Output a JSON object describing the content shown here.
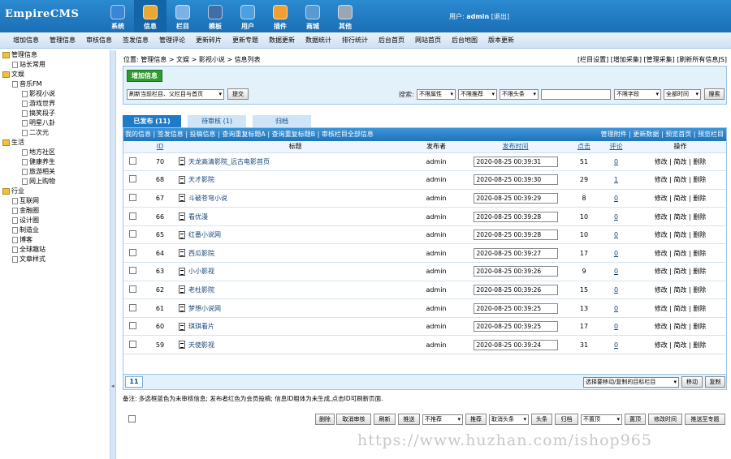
{
  "app": {
    "logo": "EmpireCMS",
    "user_label": "用户:",
    "user_name": "admin",
    "logout": "[退出]"
  },
  "topnav": [
    {
      "label": "系统",
      "color": "#3a86d6"
    },
    {
      "label": "信息",
      "color": "#e8a833"
    },
    {
      "label": "栏目",
      "color": "#7db1e6"
    },
    {
      "label": "模板",
      "color": "#3f6ea8"
    },
    {
      "label": "用户",
      "color": "#4aa0e0"
    },
    {
      "label": "插件",
      "color": "#f0a030"
    },
    {
      "label": "商城",
      "color": "#5a9ad0"
    },
    {
      "label": "其他",
      "color": "#9aa6b4"
    }
  ],
  "subnav": [
    "增加信息",
    "管理信息",
    "审核信息",
    "签发信息",
    "管理评论",
    "更新碎片",
    "更新专题",
    "数据更新",
    "数据统计",
    "排行统计",
    "后台首页",
    "网站首页",
    "后台地图",
    "版本更新"
  ],
  "sidebar": [
    {
      "label": "管理信息",
      "indent": 0,
      "type": "root"
    },
    {
      "label": "站长常用",
      "indent": 1,
      "type": "page"
    },
    {
      "label": "文娱",
      "indent": 0,
      "type": "folder"
    },
    {
      "label": "音乐FM",
      "indent": 1,
      "type": "page"
    },
    {
      "label": "影视小说",
      "indent": 2,
      "type": "page"
    },
    {
      "label": "游戏世界",
      "indent": 2,
      "type": "page"
    },
    {
      "label": "搞笑段子",
      "indent": 2,
      "type": "page"
    },
    {
      "label": "明星八卦",
      "indent": 2,
      "type": "page"
    },
    {
      "label": "二次元",
      "indent": 2,
      "type": "page"
    },
    {
      "label": "生活",
      "indent": 0,
      "type": "folder"
    },
    {
      "label": "地方社区",
      "indent": 2,
      "type": "page"
    },
    {
      "label": "健康养生",
      "indent": 2,
      "type": "page"
    },
    {
      "label": "旅游相关",
      "indent": 2,
      "type": "page"
    },
    {
      "label": "网上购物",
      "indent": 2,
      "type": "page"
    },
    {
      "label": "行业",
      "indent": 0,
      "type": "folder"
    },
    {
      "label": "互联网",
      "indent": 1,
      "type": "page"
    },
    {
      "label": "金融圈",
      "indent": 1,
      "type": "page"
    },
    {
      "label": "设计圈",
      "indent": 1,
      "type": "page"
    },
    {
      "label": "制造业",
      "indent": 1,
      "type": "page"
    },
    {
      "label": "博客",
      "indent": 1,
      "type": "page"
    },
    {
      "label": "全球趣站",
      "indent": 1,
      "type": "page"
    },
    {
      "label": "文章样式",
      "indent": 1,
      "type": "page"
    }
  ],
  "breadcrumb": "位置: 管理信息 > 文娱 > 影视小说 > 信息列表",
  "top_links": "[栏目设置] [增加采集] [管理采集] [刷新所有信息JS]",
  "add_button": "增加信息",
  "refresh_select": "刷新当前栏目、父栏目与首页",
  "submit_button": "提交",
  "search_label": "搜索:",
  "search_selects": [
    "不限属性",
    "不限推荐",
    "不限头条"
  ],
  "field_select": "不限字段",
  "time_select": "全部时间",
  "search_button": "搜索",
  "tabs": [
    {
      "label": "已发布 (11)",
      "active": true
    },
    {
      "label": "待审核 (1)",
      "active": false
    },
    {
      "label": "归档",
      "active": false
    }
  ],
  "actbar_left": "我的信息 | 签发信息 | 投稿信息 | 查询重复标题A | 查询重复标题B | 审核栏目全部信息",
  "actbar_right": "管理附件 | 更新数据 | 预览首页 | 预览栏目",
  "columns": {
    "id": "ID",
    "title": "标题",
    "publisher": "发布者",
    "time": "发布时间",
    "clicks": "点击",
    "comments": "评论",
    "ops": "操作"
  },
  "rows": [
    {
      "id": "70",
      "title": "天龙高清影院_远古电影首页",
      "publisher": "admin",
      "time": "2020-08-25 00:39:31",
      "clicks": "51",
      "comments": "0"
    },
    {
      "id": "68",
      "title": "天才影院",
      "publisher": "admin",
      "time": "2020-08-25 00:39:30",
      "clicks": "29",
      "comments": "1"
    },
    {
      "id": "67",
      "title": "斗破苍穹小说",
      "publisher": "admin",
      "time": "2020-08-25 00:39:29",
      "clicks": "8",
      "comments": "0"
    },
    {
      "id": "66",
      "title": "看优漫",
      "publisher": "admin",
      "time": "2020-08-25 00:39:28",
      "clicks": "10",
      "comments": "0"
    },
    {
      "id": "65",
      "title": "红番小说网",
      "publisher": "admin",
      "time": "2020-08-25 00:39:28",
      "clicks": "10",
      "comments": "0"
    },
    {
      "id": "64",
      "title": "西瓜影院",
      "publisher": "admin",
      "time": "2020-08-25 00:39:27",
      "clicks": "17",
      "comments": "0"
    },
    {
      "id": "63",
      "title": "小小影视",
      "publisher": "admin",
      "time": "2020-08-25 00:39:26",
      "clicks": "9",
      "comments": "0"
    },
    {
      "id": "62",
      "title": "老杜影院",
      "publisher": "admin",
      "time": "2020-08-25 00:39:26",
      "clicks": "15",
      "comments": "0"
    },
    {
      "id": "61",
      "title": "梦想小说网",
      "publisher": "admin",
      "time": "2020-08-25 00:39:25",
      "clicks": "13",
      "comments": "0"
    },
    {
      "id": "60",
      "title": "琪琪看片",
      "publisher": "admin",
      "time": "2020-08-25 00:39:25",
      "clicks": "17",
      "comments": "0"
    },
    {
      "id": "59",
      "title": "天使影视",
      "publisher": "admin",
      "time": "2020-08-25 00:39:24",
      "clicks": "31",
      "comments": "0"
    }
  ],
  "row_ops": "修改 | 简改 | 删除",
  "bottom_buttons": [
    "删除",
    "取消审核",
    "刷新",
    "推送",
    "不推荐",
    "推荐",
    "取消头条",
    "头条",
    "归档",
    "不置顶",
    "置顶",
    "修改时间",
    "推送至专题"
  ],
  "page_number": "11",
  "move_select": "选择要移动/复制的目标栏目",
  "move_button": "移动",
  "copy_button": "复制",
  "note": "备注: 多选框蓝色为未审核信息; 发布者红色为会员投稿; 信息ID粗体为未生成,点击ID可刷新页面.",
  "watermark": "https://www.huzhan.com/ishop965"
}
